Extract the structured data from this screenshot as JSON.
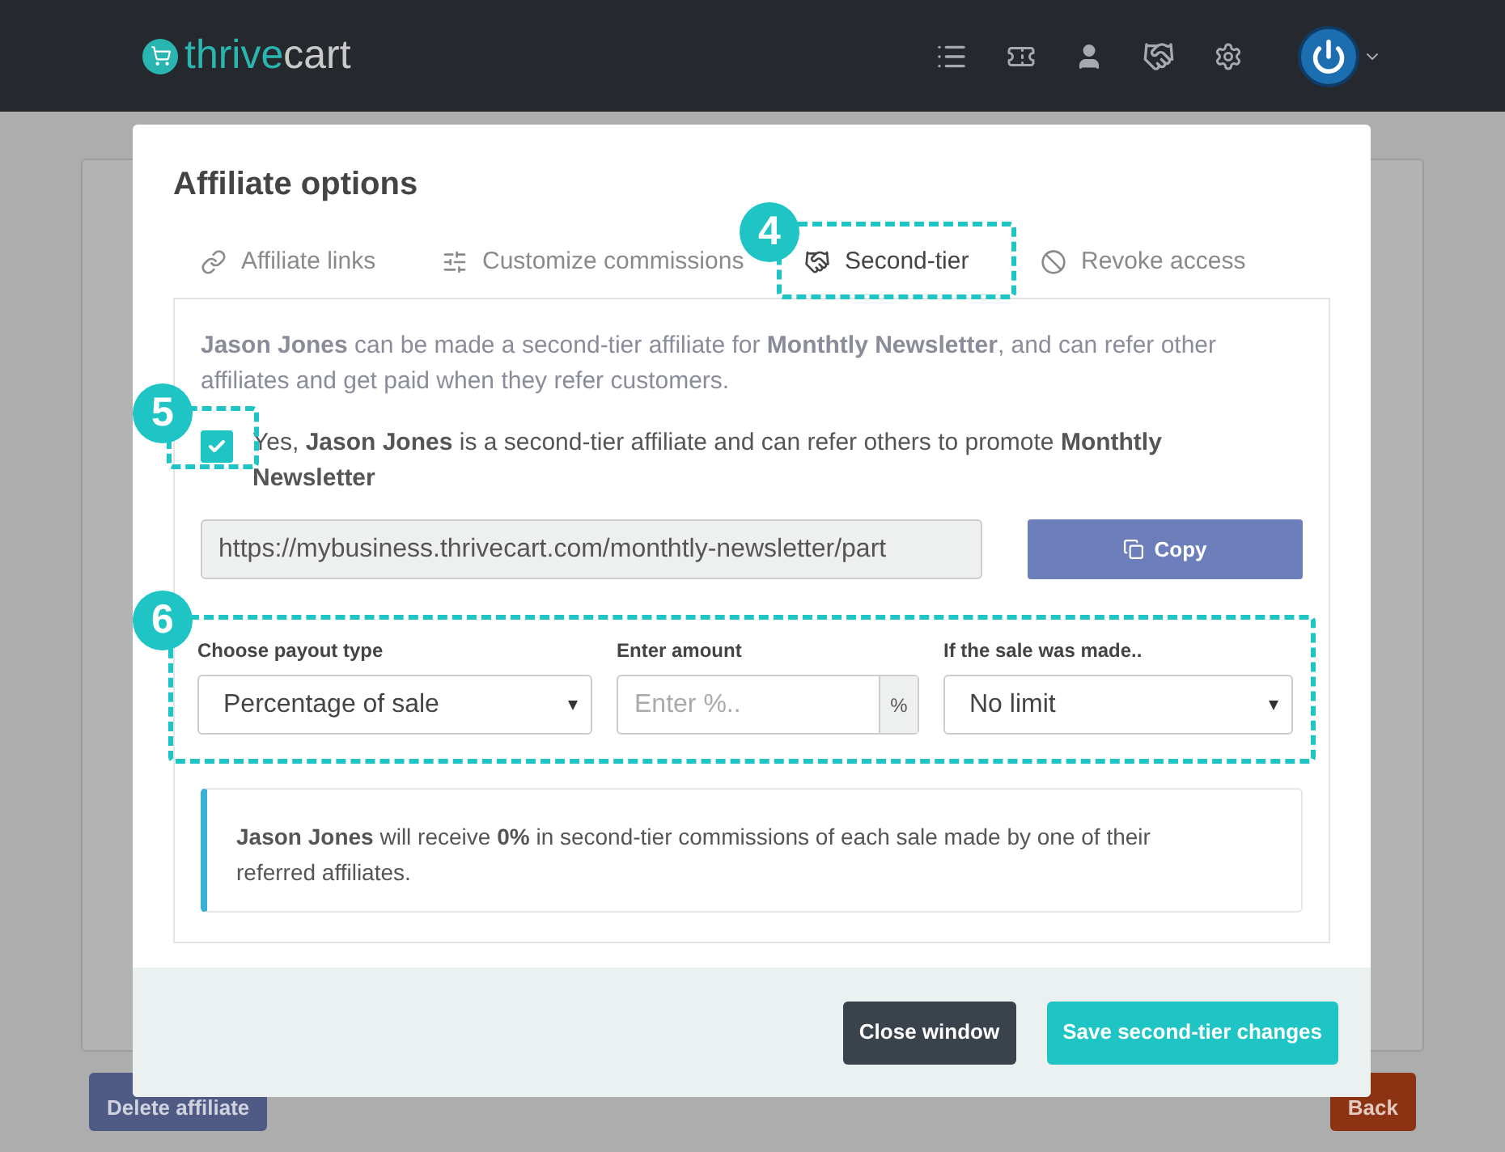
{
  "header": {
    "logo": {
      "part1": "thrive",
      "part2": "cart"
    }
  },
  "background": {
    "buttons": [
      {
        "label": "Delete affiliate",
        "kind": "delete"
      },
      {
        "label": "Back",
        "kind": "back"
      }
    ]
  },
  "modal": {
    "title": "Affiliate options",
    "tabs": [
      {
        "label": "Affiliate links",
        "kind": "link",
        "selected": false
      },
      {
        "label": "Customize commissions",
        "kind": "sliders",
        "selected": false
      },
      {
        "label": "Second-tier",
        "kind": "handshake",
        "selected": true
      },
      {
        "label": "Revoke access",
        "kind": "ban",
        "selected": false
      }
    ],
    "intro": "**Jason Jones** can be made a second-tier affiliate for **Monthtly Newsletter**, and can refer other affiliates and get paid when they refer customers.",
    "checkbox": {
      "checked": true,
      "label": "Yes, **Jason Jones** is a second-tier affiliate and can refer others to promote **Monthtly Newsletter**"
    },
    "link": {
      "value": "https://mybusiness.thrivecart.com/monthtly-newsletter/part",
      "button": "Copy"
    },
    "fields": [
      {
        "kind": "select",
        "label": "Choose payout type",
        "value": "Percentage of sale"
      },
      {
        "kind": "addon",
        "label": "Enter amount",
        "placeholder": "Enter %..",
        "addon": "%"
      },
      {
        "kind": "select",
        "label": "If the sale was made..",
        "value": "No limit"
      }
    ],
    "info": "**Jason Jones** will receive **0%** in second-tier commissions of each sale made by one of their referred affiliates.",
    "buttons": [
      {
        "label": "Close window",
        "kind": "secondary"
      },
      {
        "label": "Save second-tier changes",
        "kind": "primary"
      }
    ]
  },
  "annotations": [
    {
      "label": "4"
    },
    {
      "label": "5"
    },
    {
      "label": "6"
    }
  ]
}
